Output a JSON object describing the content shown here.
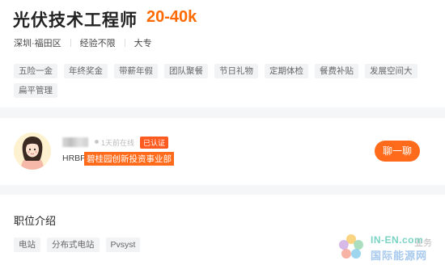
{
  "job": {
    "title": "光伏技术工程师",
    "salary": "20-40k",
    "location": "深圳·福田区",
    "experience": "经验不限",
    "education": "大专",
    "benefits": [
      "五险一金",
      "年终奖金",
      "带薪年假",
      "团队聚餐",
      "节日礼物",
      "定期体检",
      "餐费补贴",
      "发展空间大",
      "扁平管理"
    ]
  },
  "hr": {
    "online_status": "1天前在线",
    "verified_label": "已认证",
    "role": "HRBP",
    "company": "碧桂园创新投资事业部",
    "chat_button": "聊一聊"
  },
  "description": {
    "section_title": "职位介绍",
    "keywords": [
      "电站",
      "分布式电站",
      "Pvsyst"
    ]
  },
  "watermark": {
    "en": "IN-EN.com",
    "cn": "国际能源网",
    "trail": "业务"
  },
  "colors": {
    "accent": "#ff6a00",
    "tag_bg": "#f2f3f5",
    "page_bg": "#f5f6f8"
  }
}
